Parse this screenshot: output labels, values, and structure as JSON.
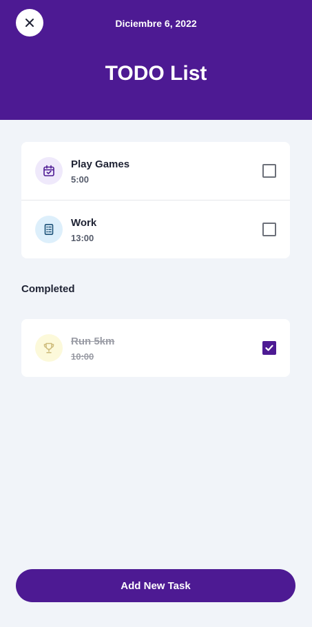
{
  "header": {
    "date": "Diciembre 6, 2022",
    "title": "TODO List",
    "background": "#4D1A93"
  },
  "tasks": [
    {
      "name": "Play Games",
      "time": "5:00",
      "icon": "calendar-check-icon",
      "icon_color": "#4D1A93",
      "icon_bg": "#EFE9FB",
      "checked": false
    },
    {
      "name": "Work",
      "time": "13:00",
      "icon": "document-list-icon",
      "icon_color": "#1C5177",
      "icon_bg": "#DDEFFB",
      "checked": false
    }
  ],
  "completed": {
    "label": "Completed",
    "tasks": [
      {
        "name": "Run 5km",
        "time": "10:00",
        "icon": "trophy-icon",
        "icon_color": "#CDBB7A",
        "icon_bg": "#FCF9DA",
        "checked": true
      }
    ]
  },
  "footer": {
    "add_label": "Add New Task"
  },
  "colors": {
    "accent": "#4D1A93",
    "background": "#F1F4F9"
  }
}
